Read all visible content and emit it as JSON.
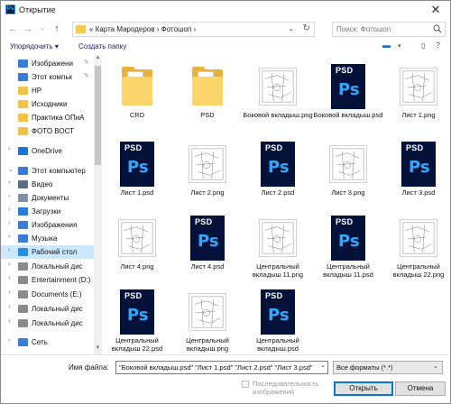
{
  "window": {
    "title": "Открытие",
    "app_icon_text": "Ps"
  },
  "navigation": {
    "breadcrumb_prefix": "«",
    "breadcrumb": [
      "Карта Мародеров",
      "Фотошоп"
    ],
    "separator": "›",
    "search_placeholder": "Поиск: Фотошоп"
  },
  "toolbar": {
    "organize_label": "Упорядочить ▾",
    "new_folder_label": "Создать папку"
  },
  "sidebar": {
    "items": [
      {
        "label": "Изображени",
        "icon": "pictures-icon",
        "color": "#3a7bd5",
        "pinned": true,
        "chevron": ""
      },
      {
        "label": "Этот компьк",
        "icon": "computer-icon",
        "color": "#3a7bd5",
        "pinned": true,
        "chevron": ""
      },
      {
        "label": "HP",
        "icon": "folder-icon",
        "color": "#f0c14b",
        "pinned": false,
        "chevron": ""
      },
      {
        "label": "Исходники",
        "icon": "folder-icon",
        "color": "#f0c14b",
        "pinned": false,
        "chevron": ""
      },
      {
        "label": "Практика ОПиА",
        "icon": "folder-icon",
        "color": "#f0c14b",
        "pinned": false,
        "chevron": ""
      },
      {
        "label": "ФОТО ВОСТ",
        "icon": "folder-icon",
        "color": "#f0c14b",
        "pinned": false,
        "chevron": ""
      },
      {
        "label": "OneDrive",
        "icon": "cloud-icon",
        "color": "#1e73d2",
        "pinned": false,
        "chevron": "›"
      },
      {
        "label": "Этот компьютер",
        "icon": "computer-icon",
        "color": "#3a7bd5",
        "pinned": false,
        "chevron": "⌄"
      },
      {
        "label": "Видео",
        "icon": "video-icon",
        "color": "#5b6d80",
        "pinned": false,
        "chevron": "›"
      },
      {
        "label": "Документы",
        "icon": "documents-icon",
        "color": "#7f8fa6",
        "pinned": false,
        "chevron": "›"
      },
      {
        "label": "Загрузки",
        "icon": "downloads-icon",
        "color": "#2a7bd5",
        "pinned": false,
        "chevron": "›"
      },
      {
        "label": "Изображения",
        "icon": "pictures-icon",
        "color": "#3a7bd5",
        "pinned": false,
        "chevron": "›"
      },
      {
        "label": "Музыка",
        "icon": "music-icon",
        "color": "#3a7bd5",
        "pinned": false,
        "chevron": "›"
      },
      {
        "label": "Рабочий стол",
        "icon": "desktop-icon",
        "color": "#2a8ee0",
        "pinned": false,
        "chevron": "›",
        "selected": true
      },
      {
        "label": "Локальный дис",
        "icon": "disk-icon",
        "color": "#8a8a8a",
        "pinned": false,
        "chevron": "›"
      },
      {
        "label": "Entertainment (D:)",
        "icon": "disk-icon",
        "color": "#8a8a8a",
        "pinned": false,
        "chevron": "›"
      },
      {
        "label": "Documents (E:)",
        "icon": "disk-icon",
        "color": "#8a8a8a",
        "pinned": false,
        "chevron": "›"
      },
      {
        "label": "Локальный дис",
        "icon": "disk-icon",
        "color": "#8a8a8a",
        "pinned": false,
        "chevron": "›"
      },
      {
        "label": "Локальный дис",
        "icon": "disk-icon",
        "color": "#8a8a8a",
        "pinned": false,
        "chevron": "›"
      },
      {
        "label": "Сеть",
        "icon": "network-icon",
        "color": "#3a7bd5",
        "pinned": false,
        "chevron": "›"
      }
    ]
  },
  "files": [
    {
      "name": "CRD",
      "kind": "folder"
    },
    {
      "name": "PSD",
      "kind": "folder"
    },
    {
      "name": "Боковой вкладыш.png",
      "kind": "drawing"
    },
    {
      "name": "Боковой вкладыш.psd",
      "kind": "psd"
    },
    {
      "name": "Лист 1.png",
      "kind": "drawing"
    },
    {
      "name": "Лист 1.psd",
      "kind": "psd"
    },
    {
      "name": "Лист 2.png",
      "kind": "drawing"
    },
    {
      "name": "Лист 2.psd",
      "kind": "psd"
    },
    {
      "name": "Лист 3.png",
      "kind": "drawing"
    },
    {
      "name": "Лист 3.psd",
      "kind": "psd"
    },
    {
      "name": "Лист 4.png",
      "kind": "drawing"
    },
    {
      "name": "Лист 4.psd",
      "kind": "psd"
    },
    {
      "name": "Центральный вкладыш 11.png",
      "kind": "drawing"
    },
    {
      "name": "Центральный вкладыш 11.psd",
      "kind": "psd"
    },
    {
      "name": "Центральный вкладыш 22.png",
      "kind": "drawing"
    },
    {
      "name": "Центральный вкладыш 22.psd",
      "kind": "psd"
    },
    {
      "name": "Центральный вкладыш.png",
      "kind": "drawing"
    },
    {
      "name": "Центральный вкладыш.psd",
      "kind": "psd"
    }
  ],
  "psd_tag": "PSD",
  "psd_logo": "Ps",
  "footer": {
    "filename_label": "Имя файла:",
    "filename_value": "\"Боковой вкладыш.psd\" \"Лист 1.psd\" \"Лист 2.psd\" \"Лист 3.psd\"",
    "format_value": "Все форматы (*.*)",
    "sequence_label": "Последовательность изображений",
    "open_label": "Открыть",
    "cancel_label": "Отмена"
  },
  "colors": {
    "psd_bg": "#04123a",
    "ps_blue": "#31a8ff",
    "selection": "#cce8ff",
    "folder": "#f6c955"
  }
}
